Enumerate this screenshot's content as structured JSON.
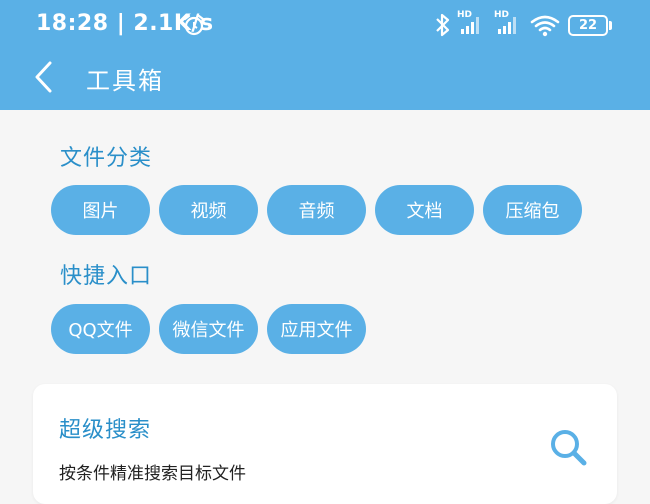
{
  "status_bar": {
    "time": "18:28 | 2.1K/s",
    "battery": "22",
    "signal1_label": "HD",
    "signal2_label": "HD"
  },
  "header": {
    "title": "工具箱"
  },
  "file_categories": {
    "title": "文件分类",
    "items": [
      "图片",
      "视频",
      "音频",
      "文档",
      "压缩包"
    ]
  },
  "quick_entry": {
    "title": "快捷入口",
    "items": [
      "QQ文件",
      "微信文件",
      "应用文件"
    ]
  },
  "super_search": {
    "title": "超级搜索",
    "description": "按条件精准搜索目标文件"
  },
  "colors": {
    "accent": "#5ab0e6",
    "section_title": "#2a8fc9",
    "background": "#f6f6f6"
  },
  "icons": [
    "alarm-icon",
    "bluetooth-icon",
    "signal-icon",
    "wifi-icon",
    "battery-icon",
    "back-arrow-icon",
    "search-icon"
  ]
}
